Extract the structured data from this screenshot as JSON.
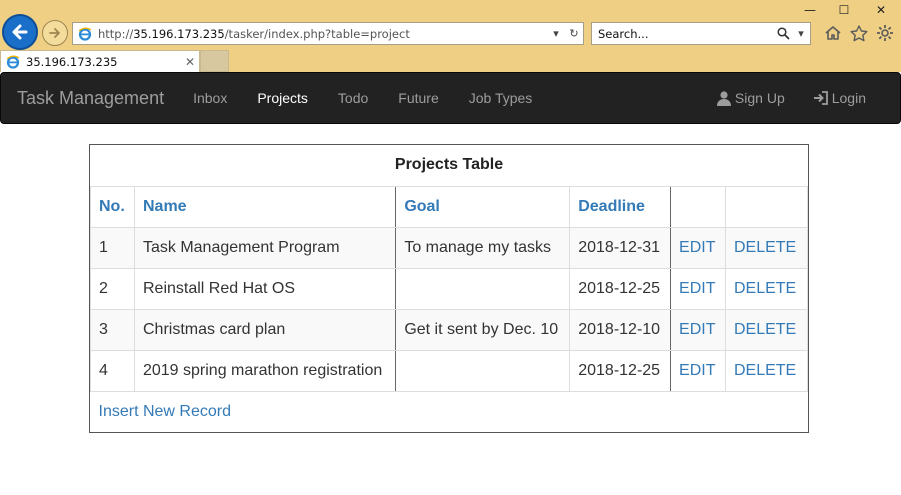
{
  "browser": {
    "url_prefix": "http://",
    "url_host": "35.196.173.235",
    "url_path": "/tasker/index.php?table=project",
    "search_placeholder": "Search...",
    "tab_title": "35.196.173.235",
    "window_controls": [
      "minimize-icon",
      "maximize-icon",
      "close-icon"
    ],
    "toolbar_icons": [
      "home-icon",
      "star-icon",
      "gear-icon"
    ],
    "accent_color": "#1a6fc9",
    "frame_color": "#eecf84"
  },
  "navbar": {
    "brand": "Task Management",
    "items": [
      {
        "label": "Inbox",
        "active": false
      },
      {
        "label": "Projects",
        "active": true
      },
      {
        "label": "Todo",
        "active": false
      },
      {
        "label": "Future",
        "active": false
      },
      {
        "label": "Job Types",
        "active": false
      }
    ],
    "signup": "Sign Up",
    "login": "Login",
    "background_color": "#222222",
    "active_color": "#ffffff",
    "inactive_color": "#9d9d9d"
  },
  "table": {
    "title": "Projects Table",
    "headers": [
      "No.",
      "Name",
      "Goal",
      "Deadline",
      "",
      ""
    ],
    "rows": [
      {
        "no": "1",
        "name": "Task Management Program",
        "goal": "To manage my tasks",
        "deadline": "2018-12-31",
        "edit": "EDIT",
        "delete": "DELETE"
      },
      {
        "no": "2",
        "name": "Reinstall Red Hat OS",
        "goal": "",
        "deadline": "2018-12-25",
        "edit": "EDIT",
        "delete": "DELETE"
      },
      {
        "no": "3",
        "name": "Christmas card plan",
        "goal": "Get it sent by Dec. 10",
        "deadline": "2018-12-10",
        "edit": "EDIT",
        "delete": "DELETE"
      },
      {
        "no": "4",
        "name": "2019 spring marathon registration",
        "goal": "",
        "deadline": "2018-12-25",
        "edit": "EDIT",
        "delete": "DELETE"
      }
    ],
    "insert_label": "Insert New Record",
    "link_color": "#337ab7"
  }
}
